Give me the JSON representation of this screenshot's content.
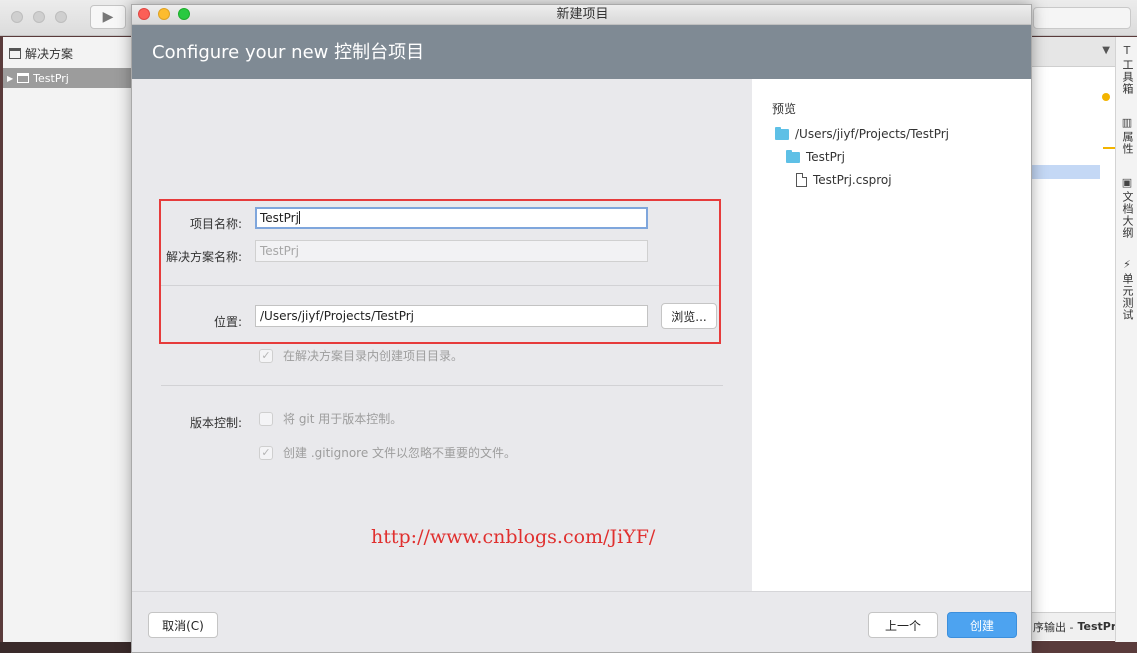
{
  "ide": {
    "sidebar_title": "解决方案",
    "tree_item": "TestPrj",
    "status_prefix": "序输出 -",
    "status_project": "TestPrj",
    "right_tools": [
      "工具箱",
      "属性",
      "文档大纲",
      "单元测试"
    ]
  },
  "dialog": {
    "window_title": "新建项目",
    "header": "Configure your new 控制台项目",
    "form": {
      "project_name_label": "项目名称:",
      "project_name_value": "TestPrj",
      "solution_name_label": "解决方案名称:",
      "solution_name_value": "TestPrj",
      "location_label": "位置:",
      "location_value": "/Users/jiyf/Projects/TestPrj",
      "browse_label": "浏览...",
      "create_dir_label": "在解决方案目录内创建项目目录。",
      "version_control_label": "版本控制:",
      "use_git_label": "将 git 用于版本控制。",
      "gitignore_label": "创建 .gitignore 文件以忽略不重要的文件。"
    },
    "watermark": "http://www.cnblogs.com/JiYF/",
    "preview": {
      "title": "预览",
      "root": "/Users/jiyf/Projects/TestPrj",
      "folder": "TestPrj",
      "file": "TestPrj.csproj"
    },
    "footer": {
      "cancel": "取消(C)",
      "previous": "上一个",
      "create": "创建"
    }
  },
  "colors": {
    "header_bg": "#7f8a94",
    "primary_button": "#4da3f0",
    "highlight_box": "#e63b3b",
    "watermark": "#e0302f",
    "folder_icon": "#5ec0e6"
  }
}
